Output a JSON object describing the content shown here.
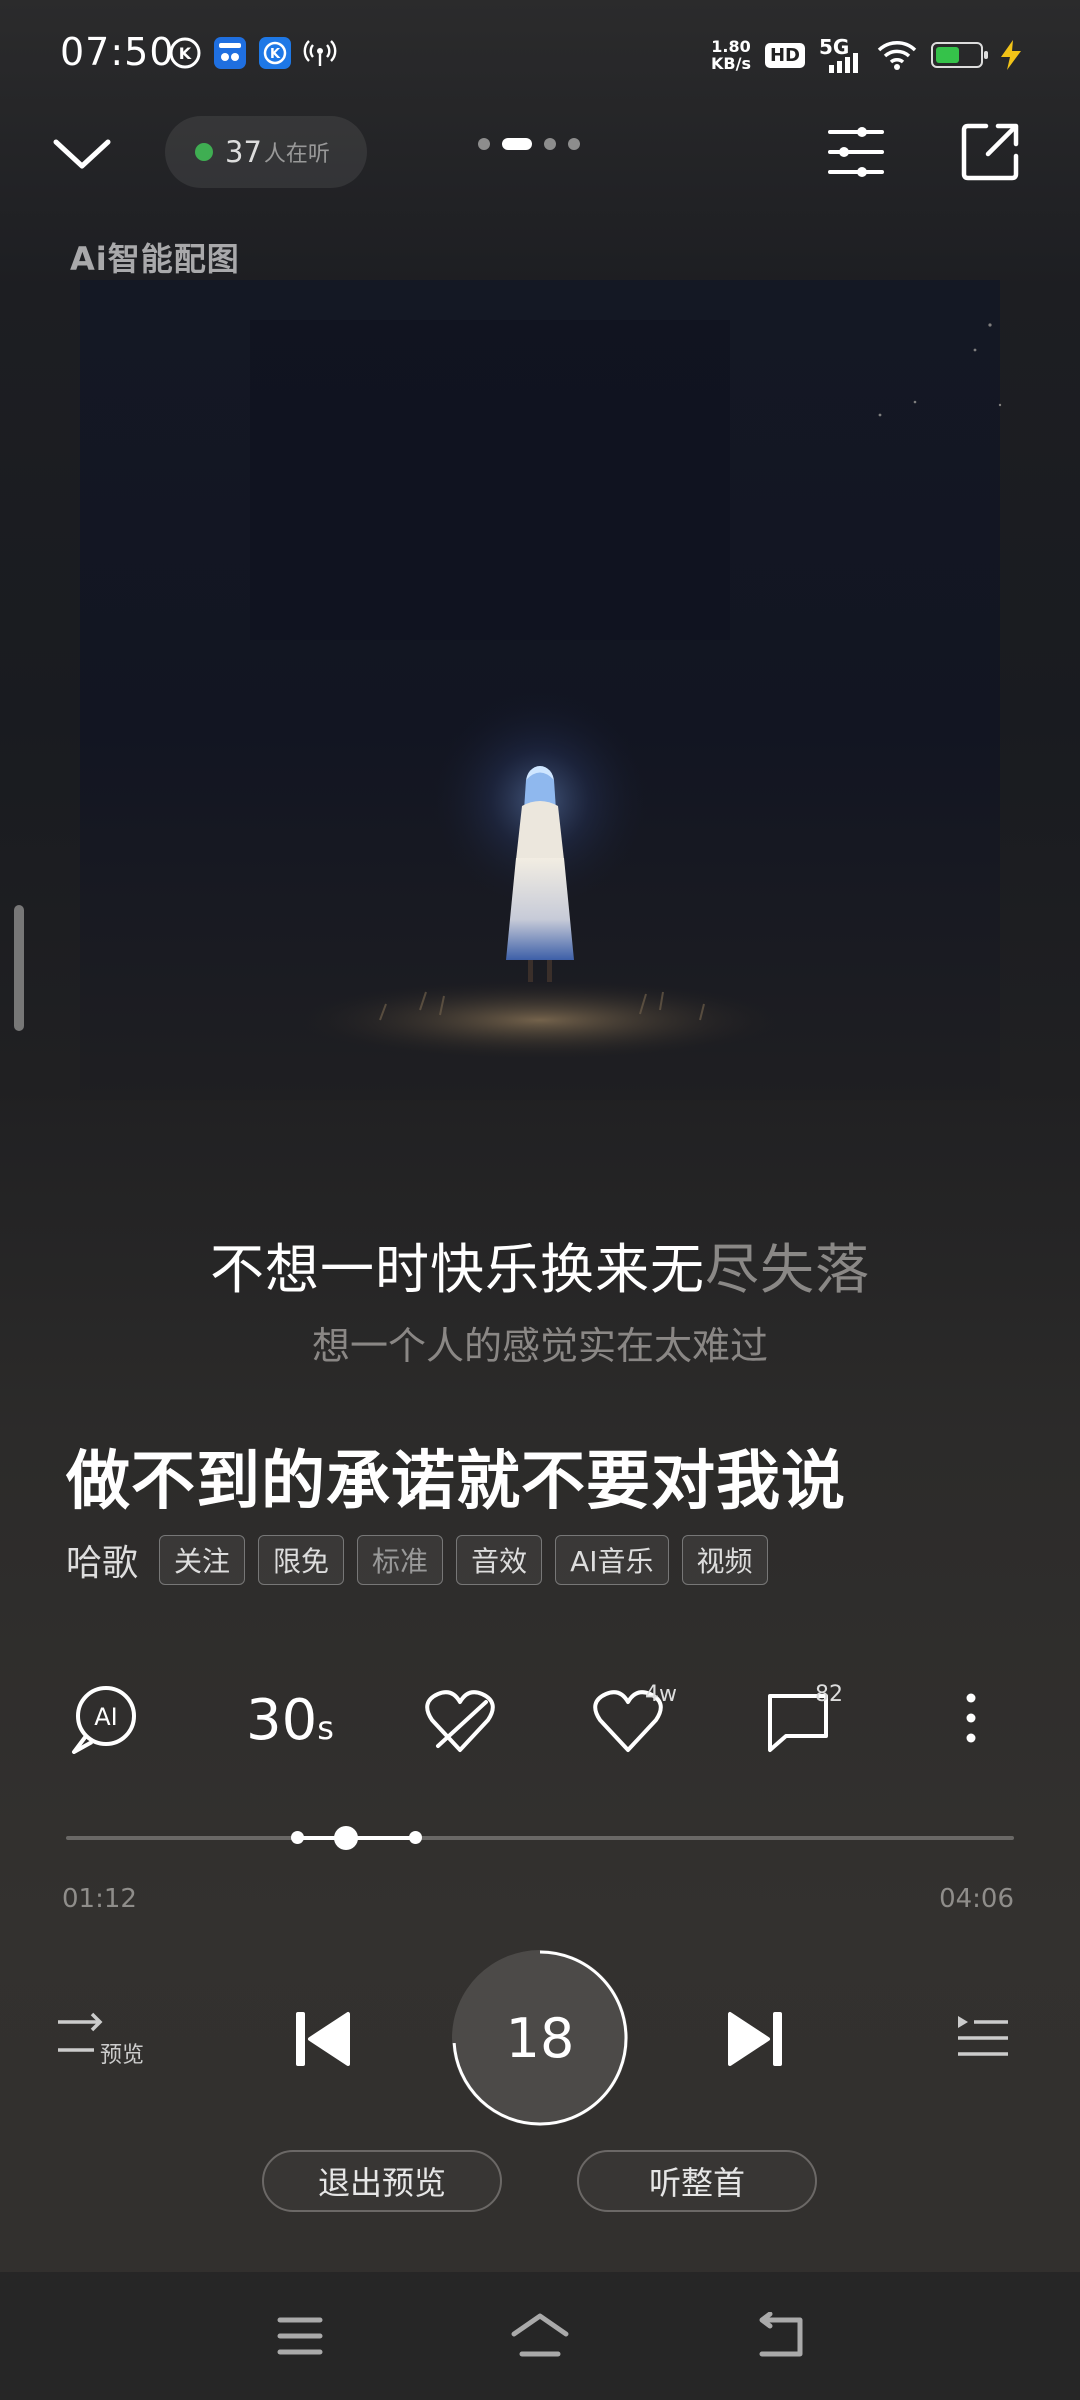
{
  "status_bar": {
    "time": "07:50",
    "net_speed_value": "1.80",
    "net_speed_unit": "KB/s",
    "hd": "HD",
    "network": "5G",
    "battery_level": 0.55,
    "battery_color": "#35c24a"
  },
  "header": {
    "listeners_count": "37",
    "listeners_text": "人在听",
    "page_count": 4,
    "active_page": 2
  },
  "artwork": {
    "ai_label": "Ai智能配图"
  },
  "lyrics": {
    "current_sung": "不想一时快乐换来无",
    "current_rest": "尽失落",
    "next": "想一个人的感觉实在太难过"
  },
  "song": {
    "title": "做不到的承诺就不要对我说",
    "artist": "哈歌",
    "tags": [
      "关注",
      "限免",
      "标准",
      "音效",
      "AI音乐",
      "视频"
    ]
  },
  "actions": {
    "ai_icon_text": "AI",
    "clip_label": "30",
    "clip_unit": "s",
    "like_count": "4w",
    "comment_count": "82"
  },
  "progress": {
    "current": "01:12",
    "duration": "04:06",
    "position_fraction": 0.295
  },
  "controls": {
    "preview_label": "预览",
    "countdown": "18",
    "exit_preview": "退出预览",
    "listen_full": "听整首"
  },
  "colors": {
    "accent_green": "#3fae52",
    "text_primary": "#ffffff",
    "text_dim": "#8a8886"
  }
}
